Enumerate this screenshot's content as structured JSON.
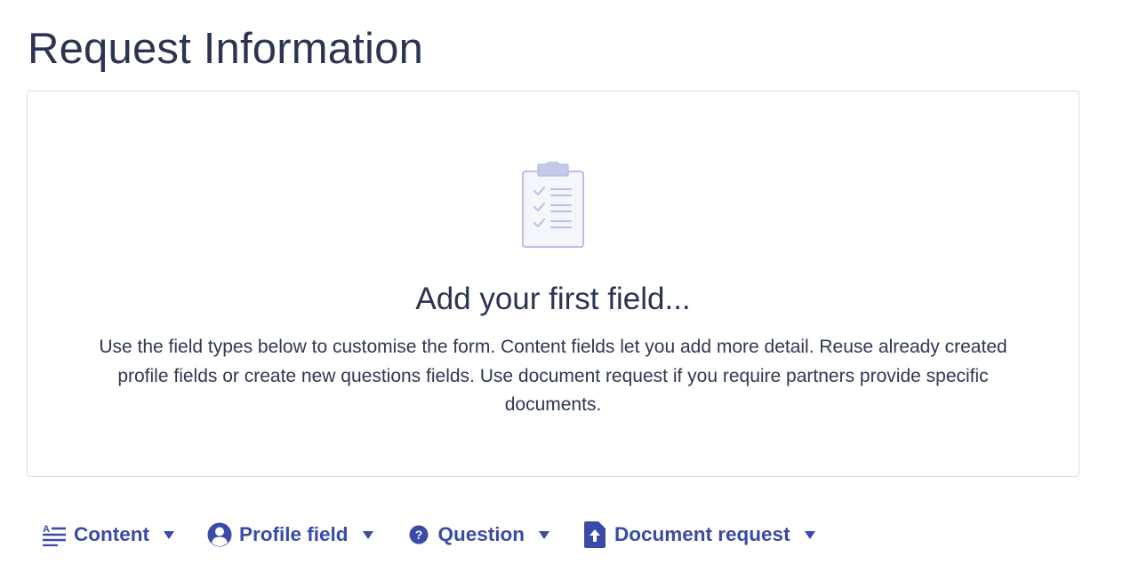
{
  "page": {
    "title": "Request Information"
  },
  "empty_state": {
    "icon": "clipboard-checklist-icon",
    "heading": "Add your first field...",
    "description": "Use the field types below to customise the form. Content fields let you add more detail. Reuse already created profile fields or create new questions fields. Use document request if you require partners provide specific documents."
  },
  "toolbar": {
    "buttons": [
      {
        "label": "Content",
        "icon": "text-content-icon"
      },
      {
        "label": "Profile field",
        "icon": "user-circle-icon"
      },
      {
        "label": "Question",
        "icon": "question-circle-icon"
      },
      {
        "label": "Document request",
        "icon": "document-upload-icon"
      }
    ]
  },
  "colors": {
    "title_text": "#2b3452",
    "accent": "#3a4aa8",
    "card_border": "#dcdde3",
    "illustration": "#b9bfe6"
  }
}
